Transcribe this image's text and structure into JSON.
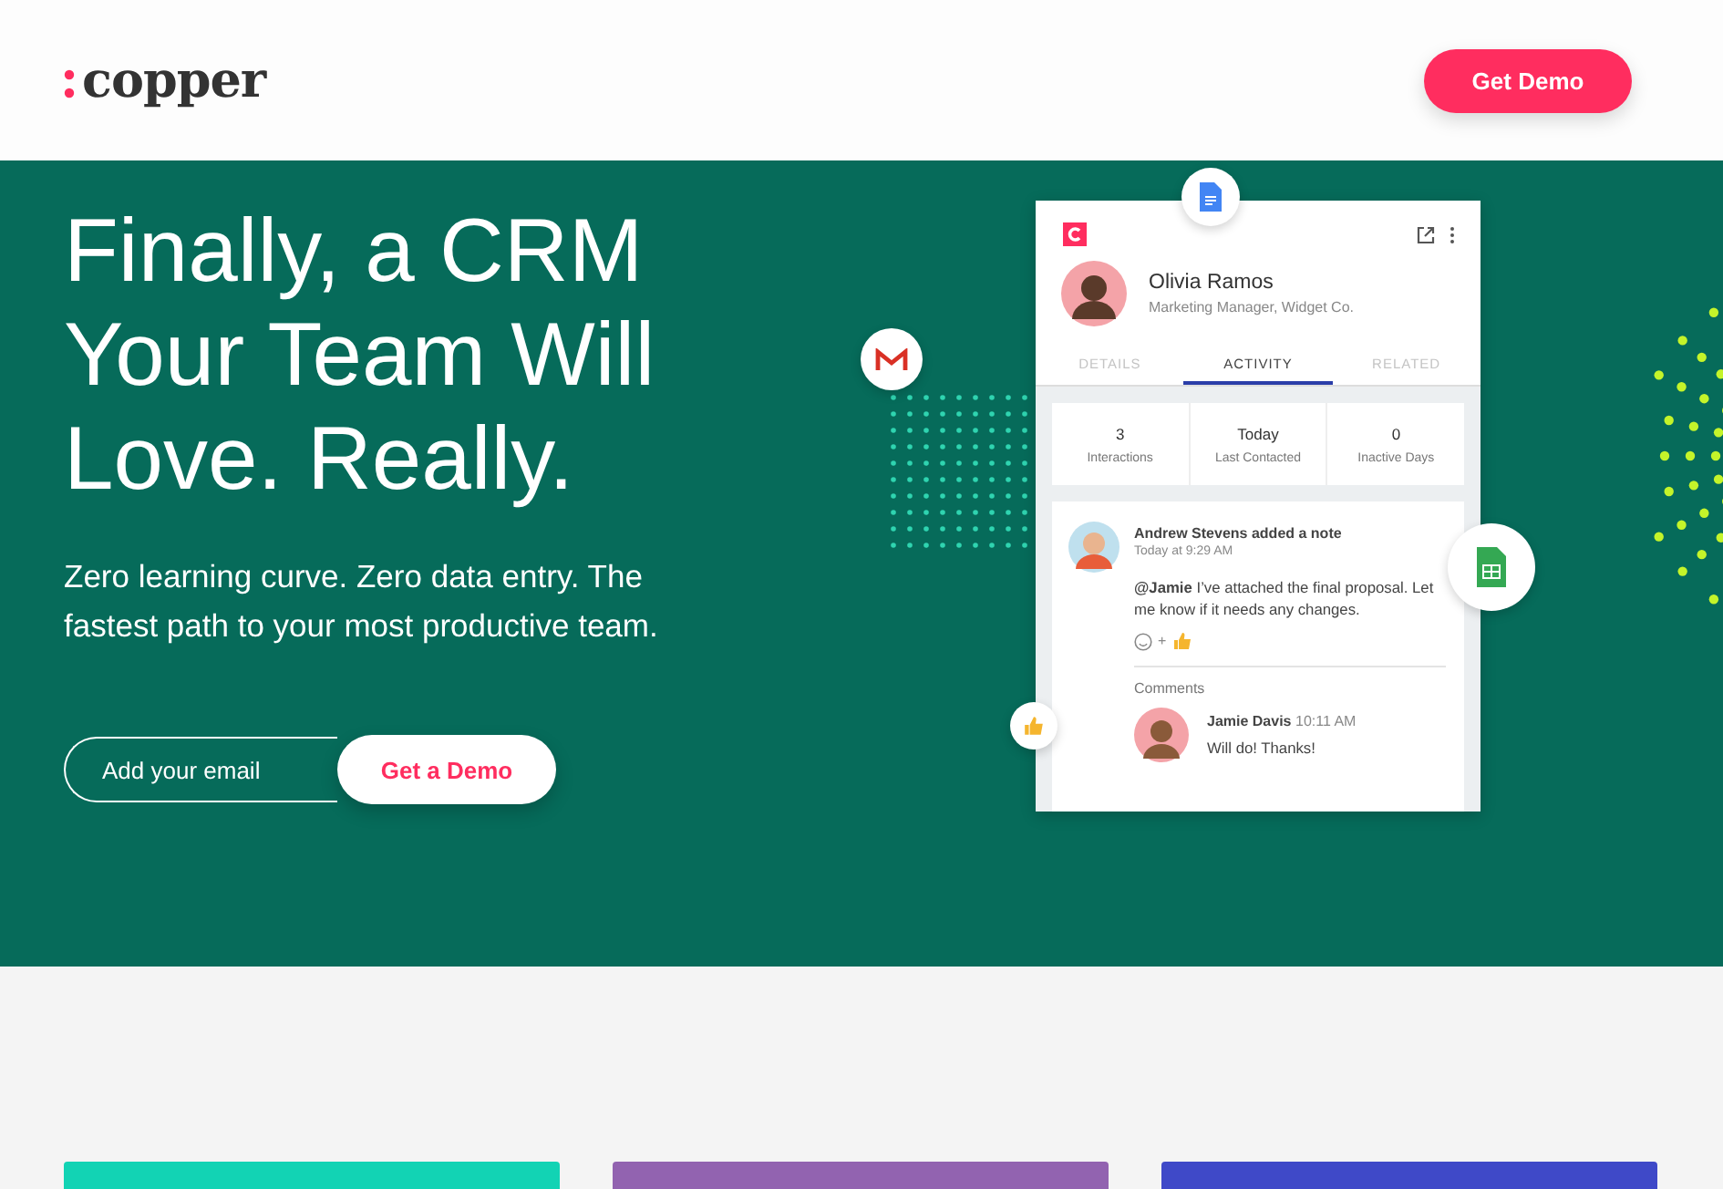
{
  "header": {
    "logo": "copper",
    "button": "Get Demo"
  },
  "hero": {
    "title_lines": [
      "Finally, a CRM",
      "Your Team Will",
      "Love. Really."
    ],
    "subtitle": "Zero learning curve. Zero data entry. The fastest path to your most productive team.",
    "email": {
      "placeholder": "Add your email"
    },
    "button": "Get a Demo"
  },
  "contact_card": {
    "name": "Olivia Ramos",
    "role": "Marketing Manager, Widget Co.",
    "tabs": [
      {
        "label": "DETAILS",
        "selected": false
      },
      {
        "label": "ACTIVITY",
        "selected": true
      },
      {
        "label": "RELATED",
        "selected": false
      }
    ],
    "stats": [
      {
        "value": "3",
        "label": "Interactions"
      },
      {
        "value": "Today",
        "label": "Last Contacted"
      },
      {
        "value": "0",
        "label": "Inactive Days"
      }
    ],
    "note": {
      "title": "Andrew Stevens added a note",
      "time": "Today at 9:29 AM",
      "body": "**@Jamie** I’ve attached the final proposal. Let me know if it needs any changes.",
      "reaction_plus": "+"
    },
    "comments_label": "Comments",
    "comment": {
      "author": "Jamie Davis",
      "time": "10:11 AM",
      "text": "Will do! Thanks!"
    }
  },
  "feature_cards": [
    {
      "color": "#12d3b4"
    },
    {
      "color": "#9263b0"
    },
    {
      "color": "#3f49c8"
    }
  ]
}
